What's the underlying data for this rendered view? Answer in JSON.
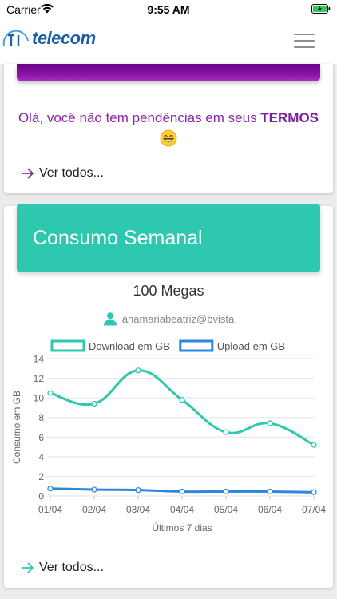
{
  "status_bar": {
    "carrier": "Carrier",
    "time": "9:55 AM",
    "icons": [
      "wifi-icon",
      "battery-charging-icon"
    ]
  },
  "nav": {
    "logo_text": "telecom",
    "menu_icon": "hamburger-menu-icon"
  },
  "terms_card": {
    "message_prefix": "Olá, você não tem pendências em seus ",
    "message_emphasis": "TERMOS",
    "emoji": "grinning-face-icon",
    "link_label": "Ver todos...",
    "accent_color": "#8e24aa"
  },
  "consumo_card": {
    "title": "Consumo Semanal",
    "plan": "100 Megas",
    "user": "anamariabeatriz@bvista",
    "link_label": "Ver todos...",
    "accent_color": "#2ec8b0"
  },
  "chart_data": {
    "type": "line",
    "x": [
      "01/04",
      "02/04",
      "03/04",
      "04/04",
      "05/04",
      "06/04",
      "07/04"
    ],
    "series": [
      {
        "name": "Download em GB",
        "color": "#2ec8b0",
        "values": [
          10.5,
          9.4,
          12.8,
          9.8,
          6.5,
          7.4,
          5.2
        ]
      },
      {
        "name": "Upload em GB",
        "color": "#2f86e0",
        "values": [
          0.75,
          0.65,
          0.6,
          0.45,
          0.45,
          0.45,
          0.38
        ]
      }
    ],
    "xlabel": "Últimos 7 dias",
    "ylabel": "Consumo em GB",
    "ylim": [
      0,
      14
    ],
    "yticks": [
      0,
      2,
      4,
      6,
      8,
      10,
      12,
      14
    ],
    "grid": true,
    "legend": "top"
  }
}
